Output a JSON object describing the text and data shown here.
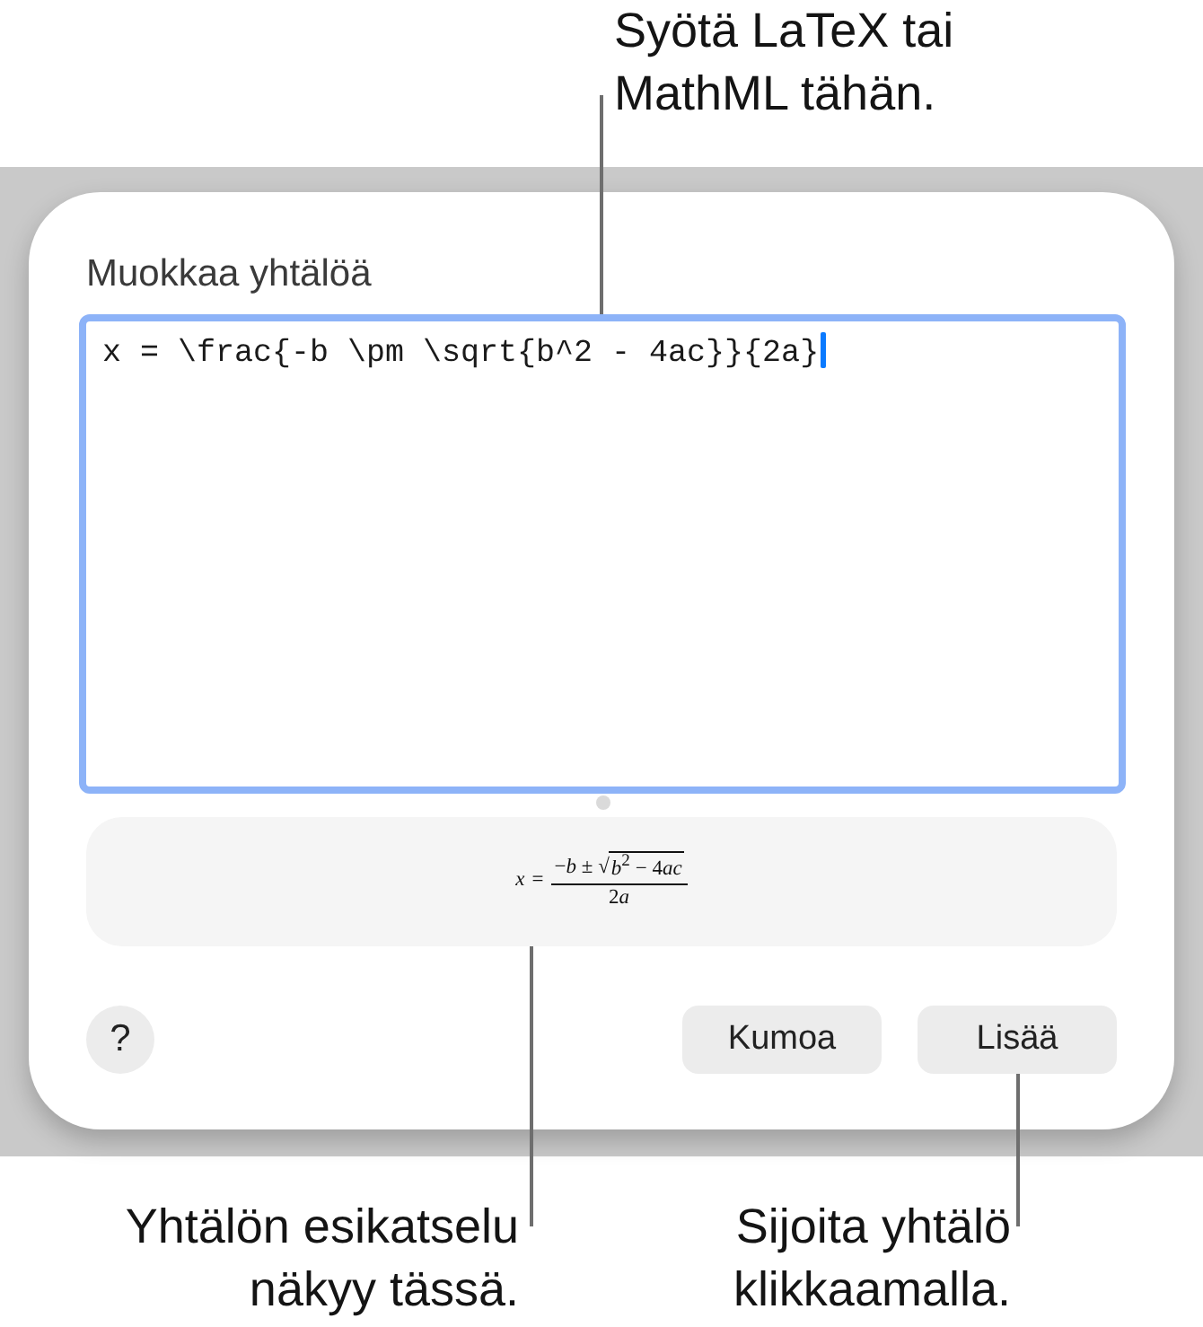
{
  "top_callout": {
    "lines": [
      "Syötä LaTeX tai",
      "MathML tähän."
    ]
  },
  "dialog": {
    "title": "Muokkaa yhtälöä",
    "editor": {
      "value": "x = \\frac{-b \\pm \\sqrt{b^2 - 4ac}}{2a}",
      "focused": true
    },
    "preview": {
      "lhs": "x",
      "relation": "=",
      "numerator": "−*b* ±",
      "radical": "√",
      "radicand": {
        "term": "*b*$^{2}$ −",
        "coefficient": "4",
        "variables": "ac"
      },
      "denominator": {
        "coefficient": "2",
        "variables": "a"
      }
    },
    "help_button": {
      "label": "?"
    },
    "buttons": [
      {
        "label": "Kumoa"
      },
      {
        "label": "Lisää"
      }
    ]
  },
  "bottom_callouts": [
    {
      "lines": [
        "Yhtälön esikatselu",
        "näkyy tässä."
      ]
    },
    {
      "lines": [
        "Sijoita yhtälö",
        "klikkaamalla."
      ]
    }
  ]
}
